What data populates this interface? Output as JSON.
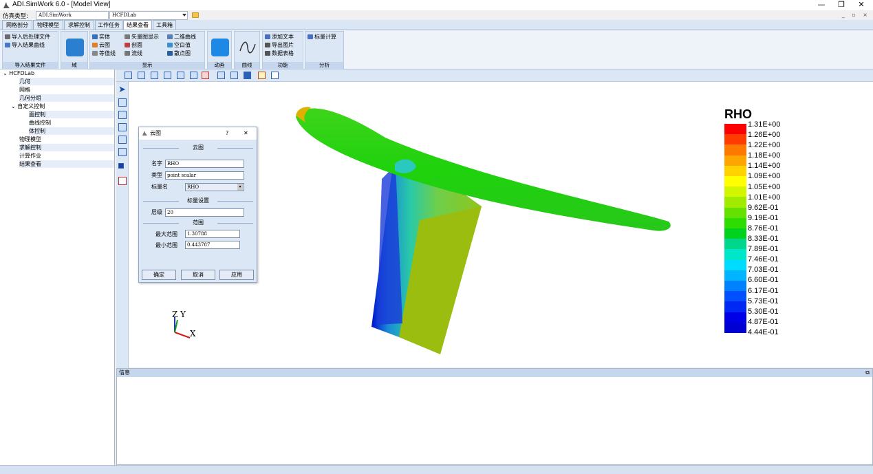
{
  "window": {
    "title": "ADI.SimWork 6.0 - [Model View]",
    "minimize": "—",
    "restore": "❐",
    "close": "✕"
  },
  "menubar": {
    "sim_type_label": "仿真类型:",
    "sim_type_value": "ADI.SimWork",
    "project_value": "HCFDLab",
    "mdi_controls": "_ ▫ ×"
  },
  "tabs": [
    "网格剖分",
    "物理模型",
    "求解控制",
    "工作任务",
    "结果查看",
    "工具箱"
  ],
  "ribbon": {
    "import": {
      "items": [
        "导入后处理文件",
        "导入结果曲线"
      ],
      "label": "导入结果文件"
    },
    "domain": {
      "label": "域"
    },
    "display": {
      "items": [
        "实体",
        "云图",
        "等值线",
        "矢量图显示",
        "剖面",
        "流线",
        "二维曲线",
        "空白值",
        "散点图"
      ],
      "label": "显示"
    },
    "animation": {
      "label": "动画"
    },
    "curve": {
      "label": "曲线"
    },
    "function": {
      "items": [
        "添加文本",
        "导出图片",
        "数据表格"
      ],
      "label": "功能"
    },
    "analysis": {
      "items": [
        "标量计算"
      ],
      "label": "分析"
    }
  },
  "tree": {
    "root": "HCFDLab",
    "items": [
      "几何",
      "网格",
      "几何分组",
      "自定义控制",
      "面控制",
      "曲线控制",
      "体控制",
      "物理模型",
      "求解控制",
      "计算作业",
      "结果查看"
    ]
  },
  "legend": {
    "title": "RHO",
    "colors": [
      "#ff0000",
      "#ff3c00",
      "#ff7800",
      "#ffa500",
      "#ffd200",
      "#ffff00",
      "#d2f500",
      "#a0eb00",
      "#64e100",
      "#2ddc00",
      "#00d21e",
      "#00d78c",
      "#00e6c8",
      "#00dcff",
      "#00b4ff",
      "#0082ff",
      "#0050ff",
      "#0028f5",
      "#0000e6",
      "#0000d2"
    ],
    "labels": [
      "1.31E+00",
      "1.26E+00",
      "1.22E+00",
      "1.18E+00",
      "1.14E+00",
      "1.09E+00",
      "1.05E+00",
      "1.01E+00",
      "9.62E-01",
      "9.19E-01",
      "8.76E-01",
      "8.33E-01",
      "7.89E-01",
      "7.46E-01",
      "7.03E-01",
      "6.60E-01",
      "6.17E-01",
      "5.73E-01",
      "5.30E-01",
      "4.87E-01",
      "4.44E-01"
    ]
  },
  "axes": {
    "z": "Z",
    "y": "Y",
    "x": "X"
  },
  "info": {
    "title": "信息"
  },
  "dialog": {
    "title": "云图",
    "help": "?",
    "close": "✕",
    "section1": "云图",
    "name_label": "名字",
    "name_value": "RHO",
    "type_label": "类型",
    "type_value": "point scalar",
    "scalar_label": "标量名",
    "scalar_value": "RHO",
    "section2": "标量设置",
    "level_label": "层级",
    "level_value": "20",
    "section3": "范围",
    "max_label": "最大范围",
    "max_value": "1.30788",
    "min_label": "最小范围",
    "min_value": "0.443787",
    "ok": "确定",
    "cancel": "取消",
    "apply": "应用"
  }
}
